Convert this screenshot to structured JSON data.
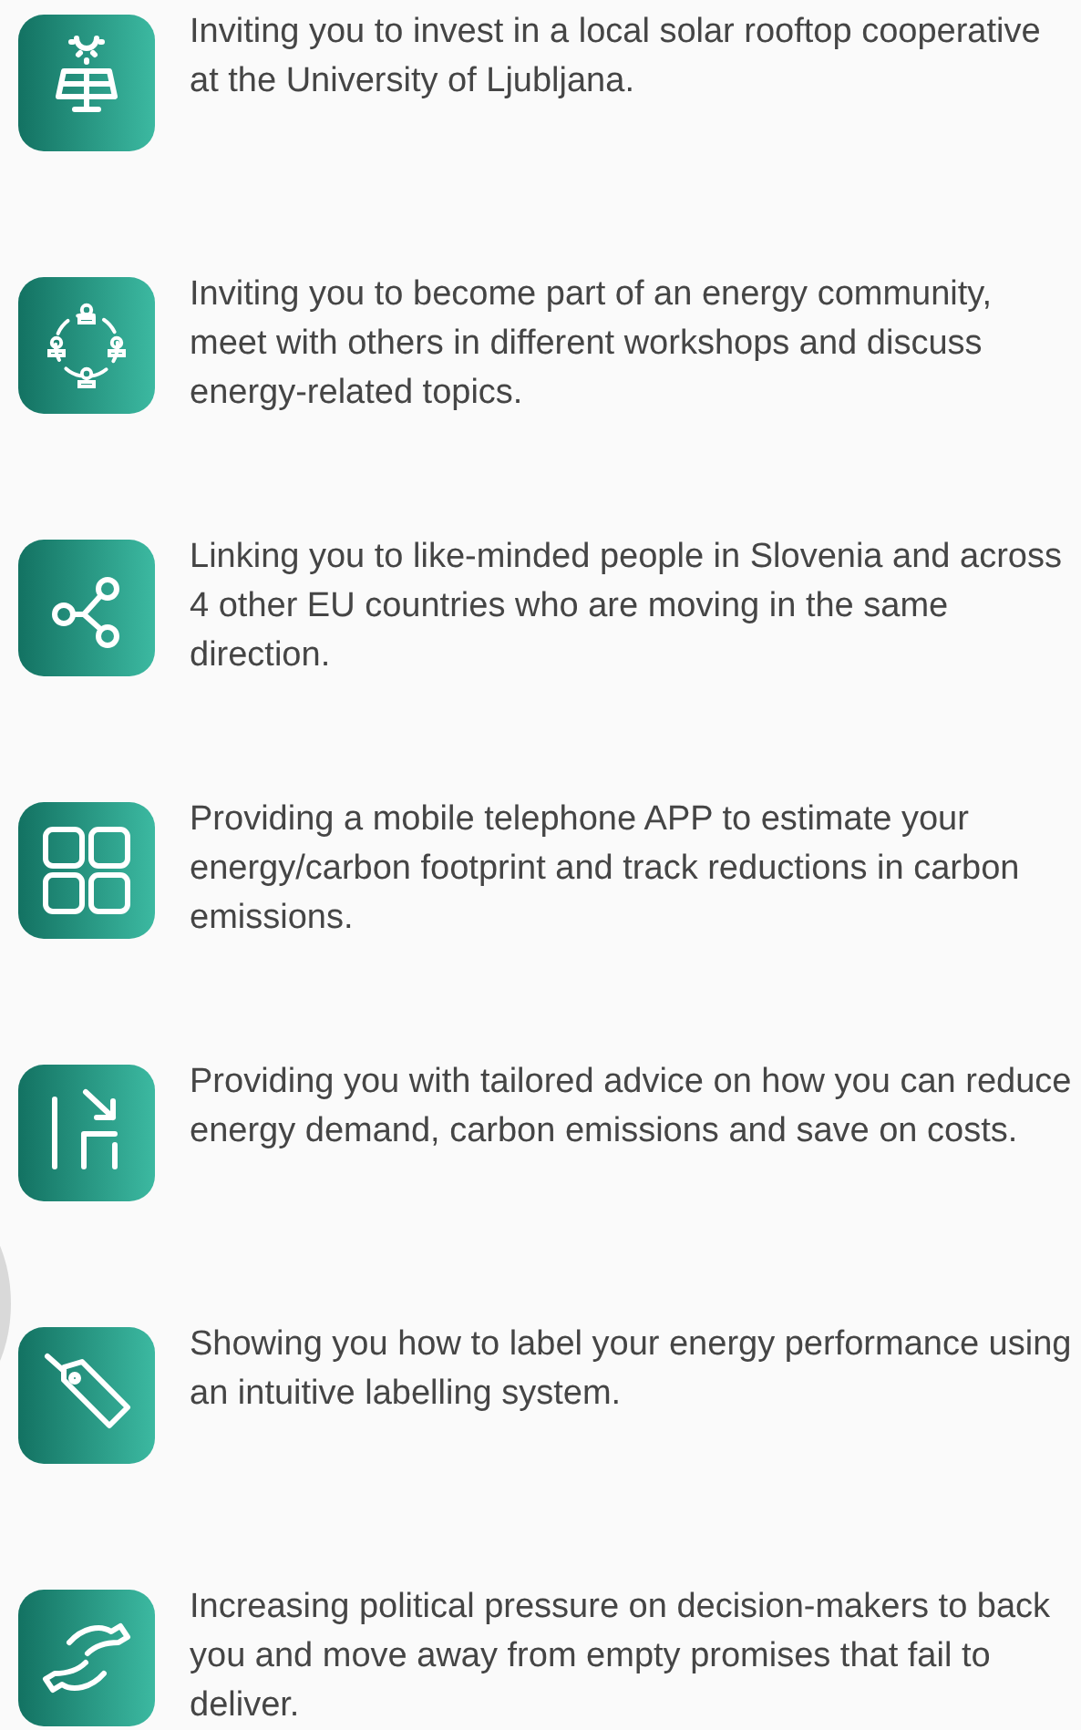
{
  "benefits": [
    {
      "kind": "solar",
      "text": "Inviting you to invest in a local solar rooftop cooperative at the University of Ljubljana."
    },
    {
      "kind": "community",
      "text": "Inviting you to become part of an energy community, meet with others in different workshops and discuss energy-related topics."
    },
    {
      "kind": "network",
      "text": "Linking you to like-minded people in Slovenia and across 4 other EU countries who are moving in the same direction."
    },
    {
      "kind": "app",
      "text": "Providing a mobile telephone APP to estimate your energy/carbon footprint and track reductions in carbon emissions."
    },
    {
      "kind": "reduce",
      "text": "Providing you with tailored advice on how you can reduce energy demand, carbon emissions and save on costs."
    },
    {
      "kind": "label",
      "text": "Showing you how to label your energy performance using an intuitive labelling system."
    },
    {
      "kind": "hands",
      "text": "Increasing political pressure on decision-makers to back you and move away from empty promises that fail to deliver."
    }
  ]
}
